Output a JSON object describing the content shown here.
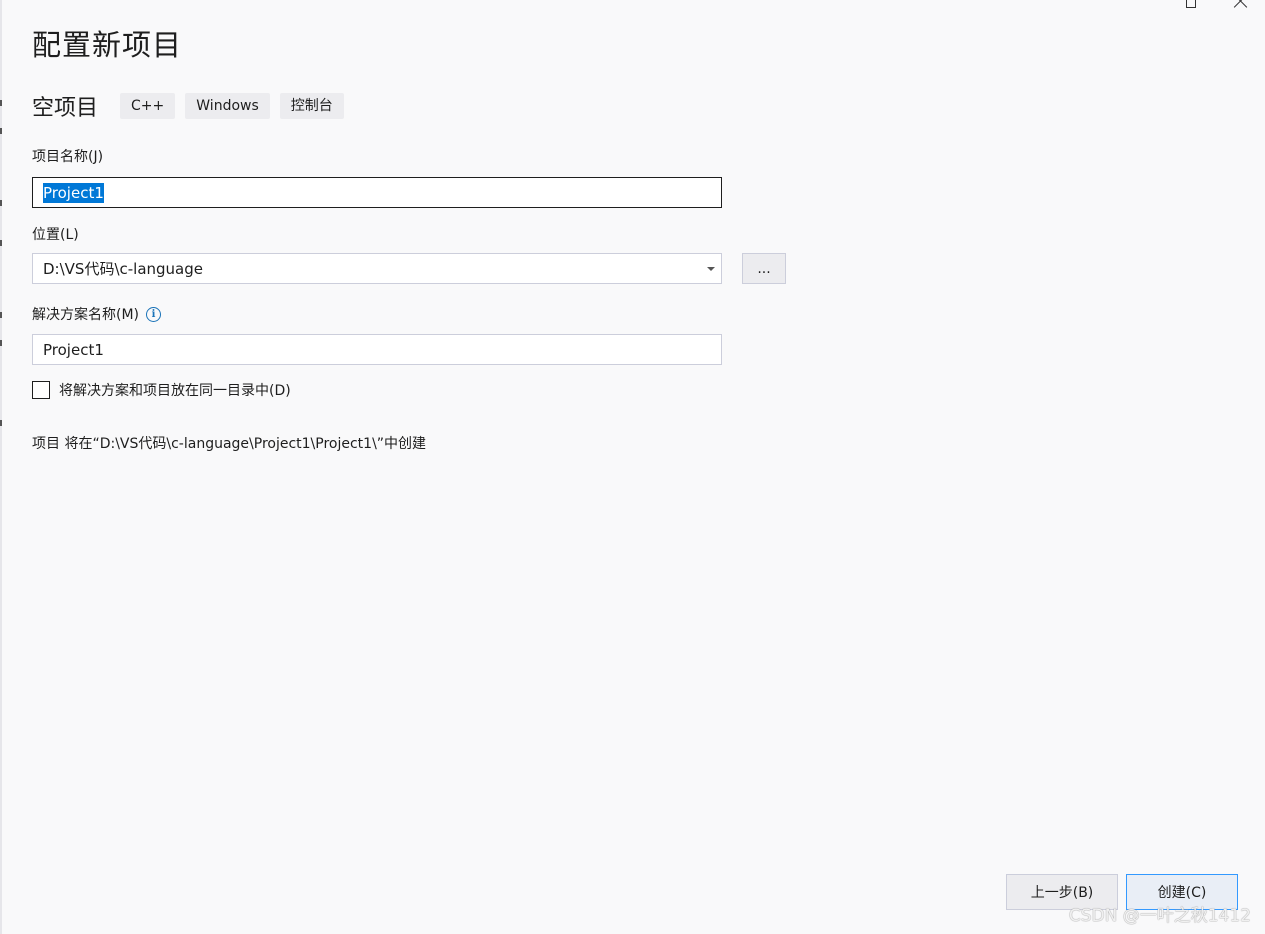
{
  "dialog": {
    "title": "配置新项目"
  },
  "template": {
    "name": "空项目",
    "tags": [
      "C++",
      "Windows",
      "控制台"
    ]
  },
  "project_name": {
    "label": "项目名称(J)",
    "value": "Project1"
  },
  "location": {
    "label": "位置(L)",
    "value": "D:\\VS代码\\c-language",
    "browse_label": "..."
  },
  "solution_name": {
    "label": "解决方案名称(M)",
    "value": "Project1",
    "info_icon": "info-icon"
  },
  "same_directory": {
    "label": "将解决方案和项目放在同一目录中(D)",
    "checked": false
  },
  "path_note": "项目 将在“D:\\VS代码\\c-language\\Project1\\Project1\\”中创建",
  "footer": {
    "back_label": "上一步(B)",
    "create_label": "创建(C)"
  },
  "watermark": "CSDN @一叶之秋1412",
  "colors": {
    "background": "#f9f9fa",
    "selection": "#0078d7",
    "info": "#1a73b8",
    "focus_border": "#3399ff"
  }
}
